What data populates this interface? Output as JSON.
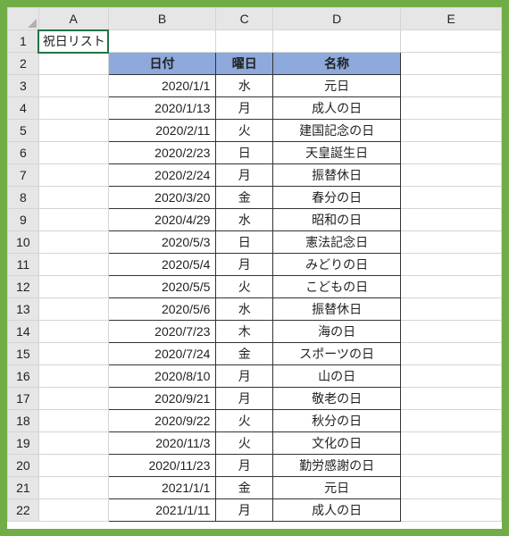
{
  "columns": [
    "A",
    "B",
    "C",
    "D",
    "E"
  ],
  "row_headers": [
    1,
    2,
    3,
    4,
    5,
    6,
    7,
    8,
    9,
    10,
    11,
    12,
    13,
    14,
    15,
    16,
    17,
    18,
    19,
    20,
    21,
    22
  ],
  "a1_value": "祝日リスト",
  "table_headers": {
    "date": "日付",
    "weekday": "曜日",
    "name": "名称"
  },
  "selected_cell": "A1",
  "holidays": [
    {
      "date": "2020/1/1",
      "weekday": "水",
      "name": "元日"
    },
    {
      "date": "2020/1/13",
      "weekday": "月",
      "name": "成人の日"
    },
    {
      "date": "2020/2/11",
      "weekday": "火",
      "name": "建国記念の日"
    },
    {
      "date": "2020/2/23",
      "weekday": "日",
      "name": "天皇誕生日"
    },
    {
      "date": "2020/2/24",
      "weekday": "月",
      "name": "振替休日"
    },
    {
      "date": "2020/3/20",
      "weekday": "金",
      "name": "春分の日"
    },
    {
      "date": "2020/4/29",
      "weekday": "水",
      "name": "昭和の日"
    },
    {
      "date": "2020/5/3",
      "weekday": "日",
      "name": "憲法記念日"
    },
    {
      "date": "2020/5/4",
      "weekday": "月",
      "name": "みどりの日"
    },
    {
      "date": "2020/5/5",
      "weekday": "火",
      "name": "こどもの日"
    },
    {
      "date": "2020/5/6",
      "weekday": "水",
      "name": "振替休日"
    },
    {
      "date": "2020/7/23",
      "weekday": "木",
      "name": "海の日"
    },
    {
      "date": "2020/7/24",
      "weekday": "金",
      "name": "スポーツの日"
    },
    {
      "date": "2020/8/10",
      "weekday": "月",
      "name": "山の日"
    },
    {
      "date": "2020/9/21",
      "weekday": "月",
      "name": "敬老の日"
    },
    {
      "date": "2020/9/22",
      "weekday": "火",
      "name": "秋分の日"
    },
    {
      "date": "2020/11/3",
      "weekday": "火",
      "name": "文化の日"
    },
    {
      "date": "2020/11/23",
      "weekday": "月",
      "name": "勤労感謝の日"
    },
    {
      "date": "2021/1/1",
      "weekday": "金",
      "name": "元日"
    },
    {
      "date": "2021/1/11",
      "weekday": "月",
      "name": "成人の日"
    }
  ]
}
